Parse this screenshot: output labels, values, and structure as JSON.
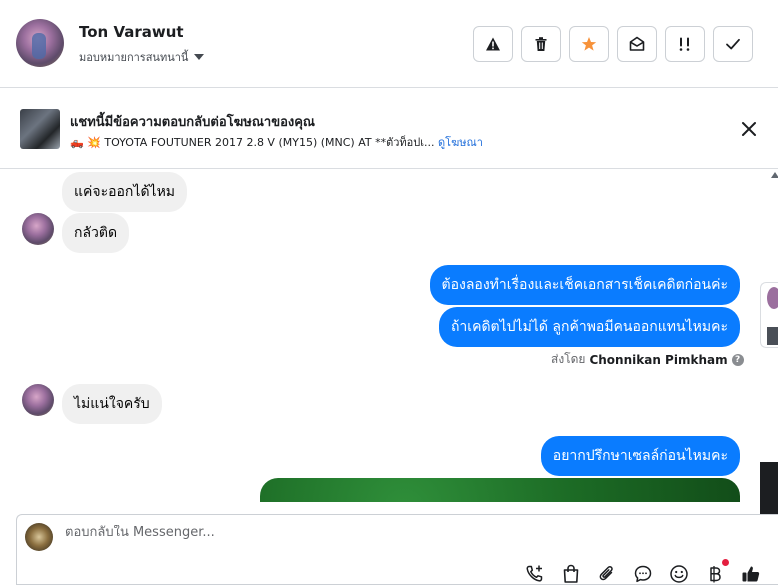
{
  "header": {
    "contact_name": "Ton Varawut",
    "assign_label": "มอบหมายการสนทนานี้",
    "actions": [
      "report",
      "delete",
      "star",
      "mark-unread",
      "follow-up",
      "done"
    ]
  },
  "ad": {
    "title": "แชทนี้มีข้อความตอบกลับต่อโฆษณาของคุณ",
    "subtitle_emojis": "🛻 💥",
    "subtitle": "TOYOTA FOUTUNER 2017 2.8 V (MY15) (MNC) AT **ตัวท็อปเ...",
    "link": "ดูโฆษณา"
  },
  "messages": {
    "in_1": "แค่จะออกได้ไหม",
    "in_2": "กลัวติด",
    "out_1": "ต้องลองทำเรื่องและเช็คเอกสารเช็คเคดิตก่อนค่ะ",
    "out_2": "ถ้าเคดิตไปไม่ได้ ลูกค้าพอมีคนออกแทนไหมคะ",
    "sent_by_prefix": "ส่งโดย",
    "sent_by_name": "Chonnikan Pimkham",
    "in_3": "ไม่แน่ใจครับ",
    "out_3": "อยากปรึกษาเซลล์ก่อนไหมคะ"
  },
  "composer": {
    "placeholder": "ตอบกลับใน Messenger..."
  },
  "toolbar_icons": [
    "phone-plus-icon",
    "shopping-bag-icon",
    "paperclip-icon",
    "chat-bubble-icon",
    "emoji-icon",
    "baht-icon",
    "thumbs-up-icon"
  ],
  "colors": {
    "outgoing_bubble": "#0a7cff",
    "incoming_bubble": "#f0f0f0",
    "star": "#f7923a",
    "link": "#216fdb"
  }
}
